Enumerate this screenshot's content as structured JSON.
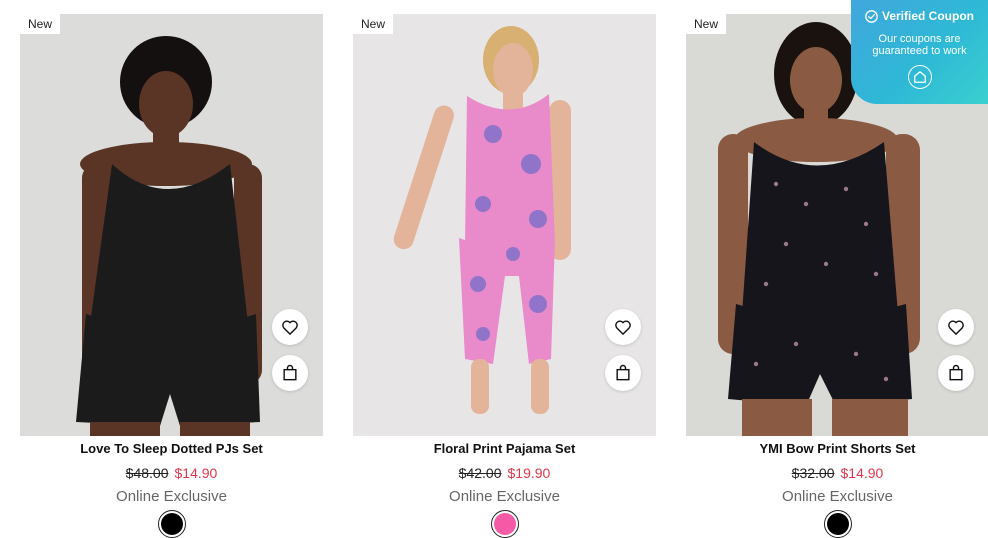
{
  "products": [
    {
      "badge": "New",
      "title": "Love To Sleep Dotted PJs Set",
      "old_price": "$48.00",
      "sale_price": "$14.90",
      "availability": "Online Exclusive",
      "swatch_color": "#000000",
      "image": {
        "background": "#dcdcda",
        "garment": "#1b1b1b",
        "skin": "#5a3526",
        "hair": "#141010"
      }
    },
    {
      "badge": "New",
      "title": "Floral Print Pajama Set",
      "old_price": "$42.00",
      "sale_price": "$19.90",
      "availability": "Online Exclusive",
      "swatch_color": "#f65aa7",
      "image": {
        "background": "#e7e5e6",
        "garment": "#e98acb",
        "skin": "#e3b49a",
        "hair": "#d8b072"
      }
    },
    {
      "badge": "New",
      "title": "YMI Bow Print Shorts Set",
      "old_price": "$32.00",
      "sale_price": "$14.90",
      "availability": "Online Exclusive",
      "swatch_color": "#000000",
      "image": {
        "background": "#d9d9d6",
        "garment": "#15151b",
        "skin": "#8b5a43",
        "hair": "#1a120e"
      }
    }
  ],
  "icons": {
    "wishlist": "heart-icon",
    "add_to_bag": "shopping-bag-icon"
  },
  "coupon": {
    "title": "Verified Coupon",
    "text": "Our coupons are guaranteed to work",
    "icon": "coupon-logo-icon"
  }
}
